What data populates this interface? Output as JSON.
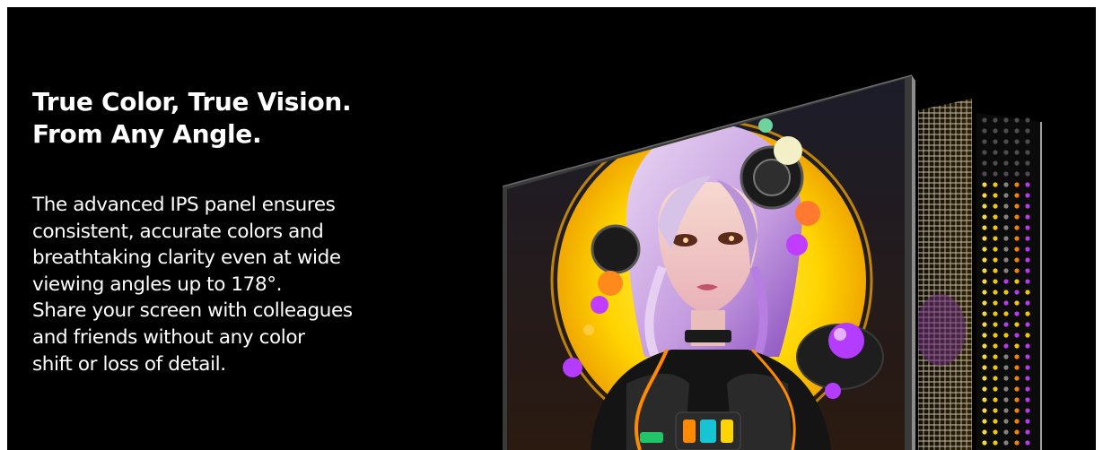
{
  "headline": {
    "line1": "True Color, True Vision.",
    "line2": "From Any Angle."
  },
  "body": {
    "lines": [
      "The advanced IPS panel ensures",
      "consistent, accurate colors and",
      "breathtaking clarity even at wide",
      "viewing angles up to 178°.",
      "Share your screen with colleagues",
      "and friends without any color",
      "shift or loss of detail."
    ]
  },
  "colors": {
    "background": "#000000",
    "text": "#ffffff",
    "accent_yellow": "#ffd400",
    "accent_purple": "#b43cff",
    "accent_orange": "#ff8a00"
  },
  "illustration": {
    "subject": "monitor-ips-panel-layers",
    "artwork": "neon-cyberpunk-girl-portrait"
  }
}
